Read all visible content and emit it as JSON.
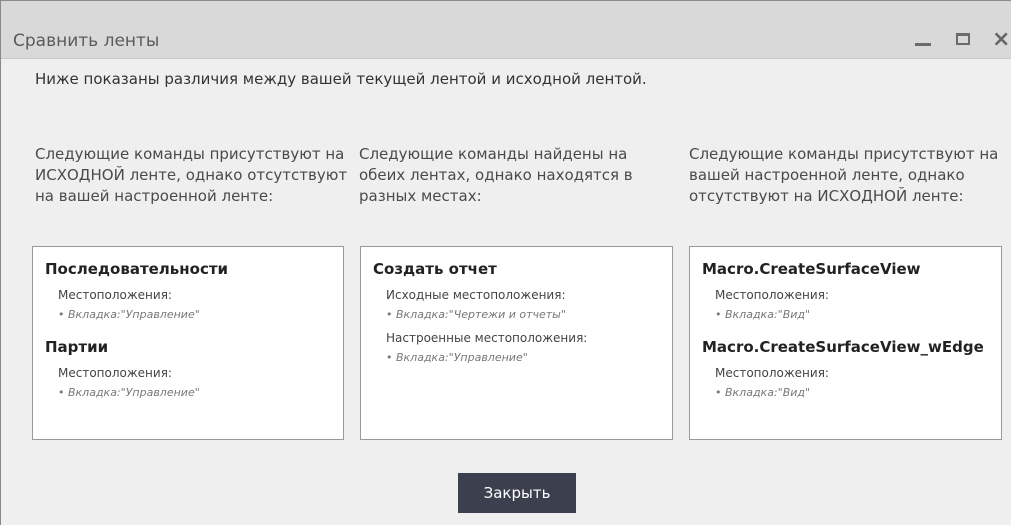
{
  "window": {
    "title": "Сравнить ленты",
    "controls": {
      "minimize": "minimize-icon",
      "maximize": "maximize-icon",
      "close": "×"
    }
  },
  "intro": "Ниже показаны различия между вашей текущей лентой и исходной лентой.",
  "columns": [
    {
      "description": "Следующие команды присутствуют на ИСХОДНОЙ ленте, однако отсутствуют на вашей настроенной ленте:",
      "items": [
        {
          "command": "Последовательности",
          "location_label": "Местоположения:",
          "location": "• Вкладка:\"Управление\""
        },
        {
          "command": "Партии",
          "location_label": "Местоположения:",
          "location": "• Вкладка:\"Управление\""
        }
      ]
    },
    {
      "description": "Следующие команды найдены на обеих лентах, однако находятся в разных местах:",
      "items": [
        {
          "command": "Создать отчет",
          "original_label": "Исходные местоположения:",
          "original_location": "• Вкладка:\"Чертежи и отчеты\"",
          "custom_label": "Настроенные местоположения:",
          "custom_location": "• Вкладка:\"Управление\""
        }
      ]
    },
    {
      "description": "Следующие команды присутствуют на вашей настроенной ленте, однако отсутствуют на ИСХОДНОЙ ленте:",
      "items": [
        {
          "command": "Macro.CreateSurfaceView",
          "location_label": "Местоположения:",
          "location": "• Вкладка:\"Вид\""
        },
        {
          "command": "Macro.CreateSurfaceView_wEdge",
          "location_label": "Местоположения:",
          "location": "• Вкладка:\"Вид\""
        }
      ]
    }
  ],
  "buttons": {
    "close": "Закрыть"
  },
  "colors": {
    "titlebar": "#d9d9d9",
    "background": "#efefef",
    "button": "#3b3f4e"
  }
}
